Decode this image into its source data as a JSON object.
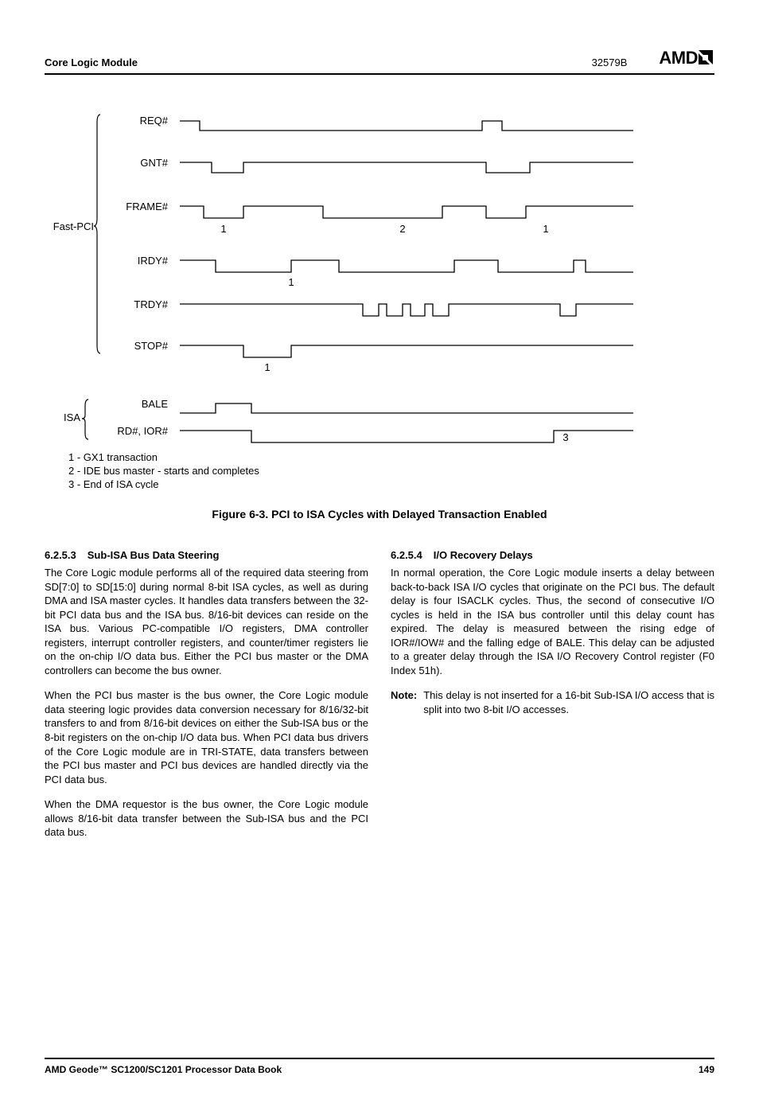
{
  "header": {
    "left": "Core Logic Module",
    "docnum": "32579B",
    "logo": "AMD"
  },
  "diagram": {
    "group1": "Fast-PCI",
    "group2": "ISA",
    "signals": {
      "req": "REQ#",
      "gnt": "GNT#",
      "frame": "FRAME#",
      "irdy": "IRDY#",
      "trdy": "TRDY#",
      "stop": "STOP#",
      "bale": "BALE",
      "rdior": "RD#, IOR#"
    },
    "numbers": {
      "frame1": "1",
      "frame2": "2",
      "frame3": "1",
      "irdy1": "1",
      "stop1": "1",
      "rd3": "3"
    },
    "notes": {
      "n1": "1 - GX1 transaction",
      "n2": "2 - IDE bus master - starts and completes",
      "n3": "3 - End of ISA cycle"
    }
  },
  "caption": "Figure 6-3.  PCI to ISA Cycles with Delayed Transaction Enabled",
  "left_section": {
    "num": "6.2.5.3",
    "title": "Sub-ISA Bus Data Steering",
    "p1": "The Core Logic module performs all of the required data steering from SD[7:0] to SD[15:0] during normal 8-bit ISA cycles, as well as during DMA and ISA master cycles. It handles data transfers between the 32-bit PCI data bus and the ISA bus. 8/16-bit devices can reside on the ISA bus. Various PC-compatible I/O registers, DMA controller registers, interrupt controller registers, and counter/timer registers lie on the on-chip I/O data bus. Either the PCI bus master or the DMA controllers can become the bus owner.",
    "p2": "When the PCI bus master is the bus owner, the Core Logic module data steering logic provides data conversion necessary for 8/16/32-bit transfers to and from 8/16-bit devices on either the Sub-ISA bus or the 8-bit registers on the on-chip I/O data bus. When PCI data bus drivers of the Core Logic module are in TRI-STATE, data transfers between the PCI bus master and PCI bus devices are handled directly via the PCI data bus.",
    "p3": "When the DMA requestor is the bus owner, the Core Logic module allows 8/16-bit data transfer between the Sub-ISA bus and the PCI data bus."
  },
  "right_section": {
    "num": "6.2.5.4",
    "title": "I/O Recovery Delays",
    "p1": "In normal operation, the Core Logic module inserts a delay between back-to-back ISA I/O cycles that originate on the PCI bus. The default delay is four ISACLK cycles. Thus, the second of consecutive I/O cycles is held in the ISA bus controller until this delay count has expired. The delay is measured between the rising edge of IOR#/IOW# and the falling edge of BALE. This delay can be adjusted to a greater delay through the ISA I/O Recovery Control register (F0 Index 51h).",
    "note_label": "Note:",
    "note_text": "This delay is not inserted for a 16-bit Sub-ISA I/O access that is split into two 8-bit I/O accesses."
  },
  "footer": {
    "left": "AMD Geode™ SC1200/SC1201 Processor Data Book",
    "right": "149"
  }
}
